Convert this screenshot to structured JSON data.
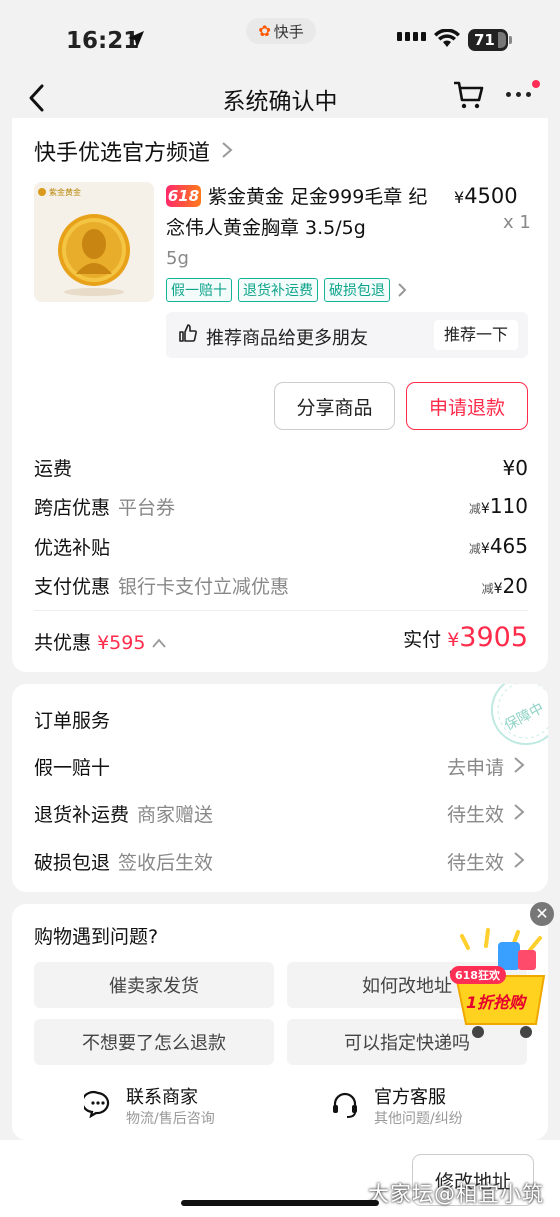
{
  "status_bar": {
    "time": "16:21",
    "app_name": "快手",
    "battery": "71"
  },
  "nav": {
    "title": "系统确认中"
  },
  "store": {
    "name": "快手优选官方频道"
  },
  "product": {
    "badge": "618",
    "title": "紫金黄金 足金999毛章 纪念伟人黄金胸章 3.5/5g",
    "price_symbol": "¥",
    "price": "4500",
    "qty": "x 1",
    "spec": "5g",
    "thumb_brand": "紫金黄金",
    "tags": [
      "假一赔十",
      "退货补运费",
      "破损包退"
    ]
  },
  "recommend": {
    "text": "推荐商品给更多朋友",
    "button": "推荐一下"
  },
  "actions": {
    "share": "分享商品",
    "refund": "申请退款"
  },
  "costs": {
    "shipping": {
      "label": "运费",
      "value": "¥0"
    },
    "cross_store": {
      "label": "跨店优惠",
      "sub": "平台券",
      "prefix": "减",
      "yen": "¥",
      "value": "110"
    },
    "subsidy": {
      "label": "优选补贴",
      "prefix": "减",
      "yen": "¥",
      "value": "465"
    },
    "payment": {
      "label": "支付优惠",
      "sub": "银行卡支付立减优惠",
      "prefix": "减",
      "yen": "¥",
      "value": "20"
    }
  },
  "summary": {
    "discount_label": "共优惠",
    "discount_value": "¥595",
    "paid_label": "实付",
    "paid_yen": "¥",
    "paid_value": "3905"
  },
  "services": {
    "title": "订单服务",
    "stamp": "保障中",
    "items": [
      {
        "label": "假一赔十",
        "sub": "",
        "value": "去申请"
      },
      {
        "label": "退货补运费",
        "sub": "商家赠送",
        "value": "待生效"
      },
      {
        "label": "破损包退",
        "sub": "签收后生效",
        "value": "待生效"
      }
    ]
  },
  "problems": {
    "title": "购物遇到问题?",
    "buttons": [
      "催卖家发货",
      "如何改地址",
      "不想要了怎么退款",
      "可以指定快递吗"
    ],
    "contacts": [
      {
        "name": "联系商家",
        "sub": "物流/售后咨询"
      },
      {
        "name": "官方客服",
        "sub": "其他问题/纠纷"
      }
    ]
  },
  "promo": {
    "line1": "618狂欢",
    "line2": "1折抢购"
  },
  "bottom": {
    "button": "修改地址"
  },
  "watermark": "大家坛@相宜小筑"
}
